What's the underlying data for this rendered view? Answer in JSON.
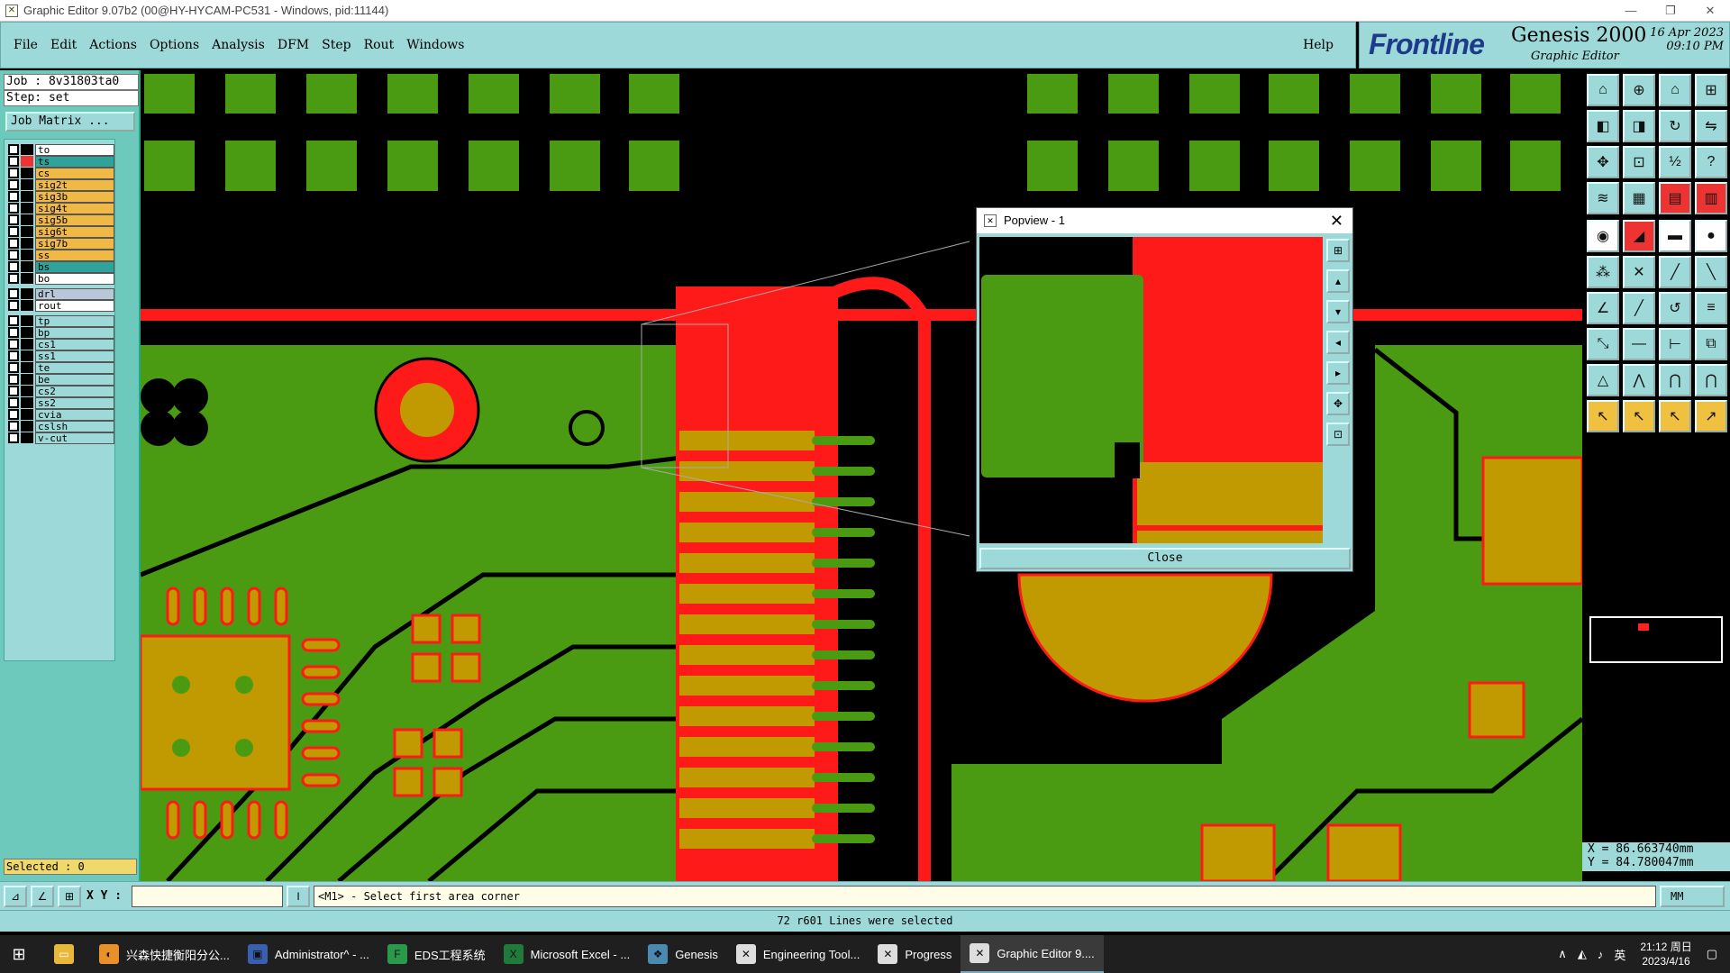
{
  "window": {
    "title": "Graphic Editor 9.07b2 (00@HY-HYCAM-PC531 - Windows, pid:11144)",
    "app_icon": "graphic-editor-icon",
    "controls": [
      "—",
      "❐",
      "✕"
    ]
  },
  "menu": {
    "items": [
      "File",
      "Edit",
      "Actions",
      "Options",
      "Analysis",
      "DFM",
      "Step",
      "Rout",
      "Windows"
    ],
    "help": "Help"
  },
  "brand": {
    "logo": "Frontline",
    "product": "Genesis 2000",
    "subtitle": "Graphic Editor",
    "date": "16 Apr 2023",
    "time": "09:10 PM"
  },
  "job": {
    "job_label": "Job  : 8v31803ta0",
    "step_label": "Step: set",
    "matrix_button": "Job Matrix ..."
  },
  "layers": [
    {
      "name": "to",
      "color": "#ffffff"
    },
    {
      "name": "ts",
      "color": "#2fa39a",
      "marker": "a"
    },
    {
      "name": "cs",
      "color": "#f0b845"
    },
    {
      "name": "sig2t",
      "color": "#f0b845"
    },
    {
      "name": "sig3b",
      "color": "#f0b845"
    },
    {
      "name": "sig4t",
      "color": "#f0b845"
    },
    {
      "name": "sig5b",
      "color": "#f0b845"
    },
    {
      "name": "sig6t",
      "color": "#f0b845"
    },
    {
      "name": "sig7b",
      "color": "#f0b845"
    },
    {
      "name": "ss",
      "color": "#f0b845"
    },
    {
      "name": "bs",
      "color": "#2fa39a"
    },
    {
      "name": "bo",
      "color": "#ffffff"
    },
    {
      "name": "drl",
      "color": "#b8c8d8"
    },
    {
      "name": "rout",
      "color": "#ffffff"
    },
    {
      "name": "tp",
      "color": "#9dd9d8"
    },
    {
      "name": "bp",
      "color": "#9dd9d8"
    },
    {
      "name": "cs1",
      "color": "#9dd9d8"
    },
    {
      "name": "ss1",
      "color": "#9dd9d8"
    },
    {
      "name": "te",
      "color": "#9dd9d8"
    },
    {
      "name": "be",
      "color": "#9dd9d8"
    },
    {
      "name": "cs2",
      "color": "#9dd9d8"
    },
    {
      "name": "ss2",
      "color": "#9dd9d8"
    },
    {
      "name": "cvia",
      "color": "#9dd9d8"
    },
    {
      "name": "cslsh",
      "color": "#9dd9d8"
    },
    {
      "name": "v-cut",
      "color": "#9dd9d8"
    }
  ],
  "selected_label": "Selected : 0",
  "coords": {
    "x": "X = 86.663740mm",
    "y": "Y = 84.780047mm"
  },
  "command": {
    "xy_label": "X Y :",
    "xy_value": "",
    "prompt": "<M1> - Select first area corner",
    "units": "MM"
  },
  "status": "72 r601 Lines were selected",
  "popview": {
    "title": "Popview - 1",
    "close_label": "Close"
  },
  "colors": {
    "copper": "#4a9a12",
    "pad": "#c09a00",
    "selected": "#ff1a1a",
    "background": "#000000",
    "panel": "#9dd9d8"
  },
  "taskbar": {
    "items": [
      {
        "label": "兴森快捷衡阳分公...",
        "icon": "browser-icon"
      },
      {
        "label": "Administrator^ - ...",
        "icon": "floppy-icon"
      },
      {
        "label": "EDS工程系统",
        "icon": "f-app-icon"
      },
      {
        "label": "Microsoft Excel - ...",
        "icon": "excel-icon"
      },
      {
        "label": "Genesis",
        "icon": "genesis-icon"
      },
      {
        "label": "Engineering Tool...",
        "icon": "graphic-editor-icon"
      },
      {
        "label": "Progress",
        "icon": "graphic-editor-icon"
      },
      {
        "label": "Graphic Editor 9....",
        "icon": "graphic-editor-icon"
      }
    ],
    "ime": "英",
    "time": "21:12 周日",
    "date": "2023/4/16"
  }
}
